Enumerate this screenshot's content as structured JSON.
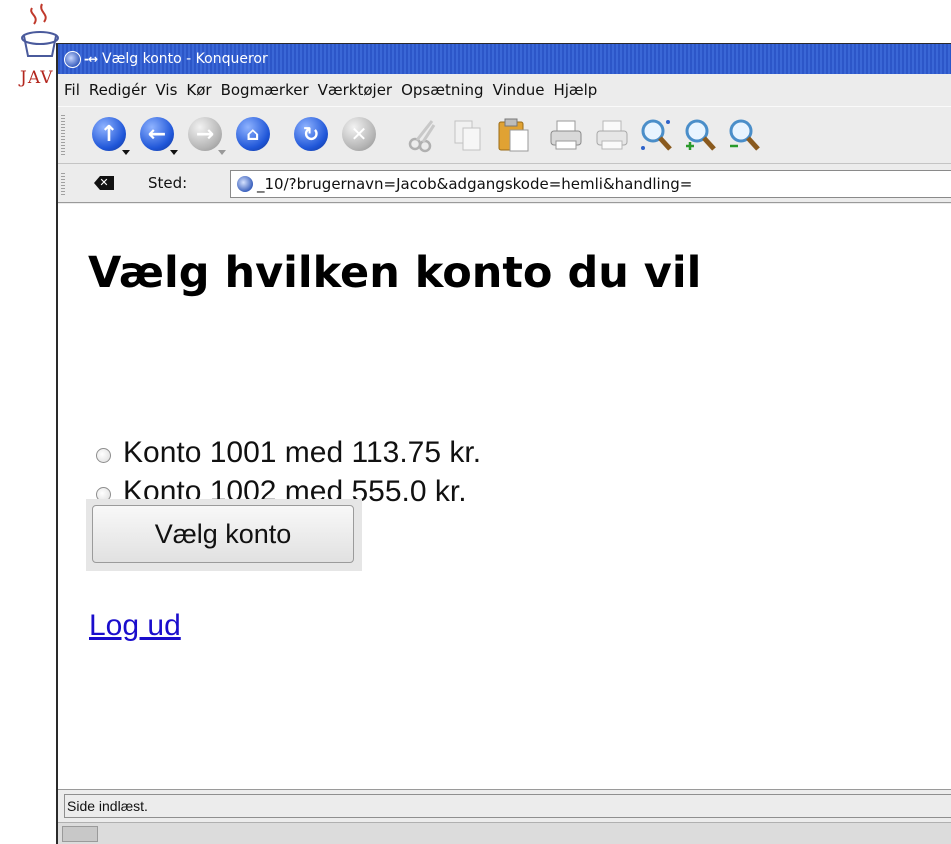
{
  "background": {
    "logo_text": "JAV"
  },
  "window": {
    "title": "Vælg konto - Konqueror",
    "title_buttons": "-↔"
  },
  "menubar": {
    "items": [
      "Fil",
      "Redigér",
      "Vis",
      "Kør",
      "Bogmærker",
      "Værktøjer",
      "Opsætning",
      "Vindue",
      "Hjælp"
    ]
  },
  "toolbar": {
    "icons": [
      "up-arrow-icon",
      "back-arrow-icon",
      "forward-arrow-icon",
      "home-icon",
      "reload-icon",
      "stop-icon",
      "cut-icon",
      "copy-icon",
      "paste-icon",
      "print-icon",
      "print-preview-icon",
      "zoom-icon",
      "zoom-in-icon",
      "zoom-out-icon"
    ]
  },
  "location": {
    "label": "Sted:",
    "url": "_10/?brugernavn=Jacob&adgangskode=hemli&handling="
  },
  "page": {
    "heading": "Vælg hvilken konto du vil",
    "accounts": [
      {
        "label": "Konto 1001 med 113.75 kr.",
        "selected": false
      },
      {
        "label": "Konto 1002 med 555.0 kr.",
        "selected": false
      }
    ],
    "submit_label": "Vælg konto",
    "logout_label": "Log ud"
  },
  "status": {
    "text": "Side indlæst."
  },
  "colors": {
    "titlebar": "#3a67d6",
    "link": "#1a0dcc",
    "window_bg": "#ececec"
  }
}
